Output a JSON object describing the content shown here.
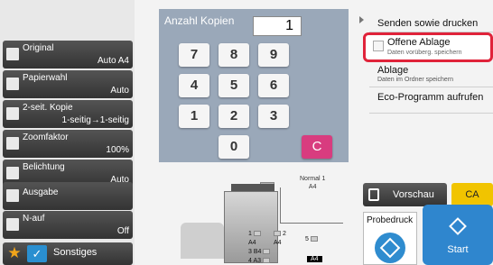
{
  "left_panel": {
    "items": [
      {
        "title": "Original",
        "value": "Auto    A4",
        "icon": "document-icon"
      },
      {
        "title": "Papierwahl",
        "value": "Auto",
        "icon": "paper-icon"
      },
      {
        "title": "2-seit. Kopie",
        "value": "1-seitig→1-seitig",
        "icon": "duplex-icon"
      },
      {
        "title": "Zoomfaktor",
        "value": "100%",
        "icon": "zoom-icon"
      },
      {
        "title": "Belichtung",
        "value": "Auto",
        "icon": "exposure-icon"
      },
      {
        "title": "Ausgabe",
        "value": "",
        "icon": "output-icon"
      },
      {
        "title": "N-auf",
        "value": "Off",
        "icon": "n-up-icon"
      }
    ],
    "bottom": {
      "other_label": "Sonstiges"
    }
  },
  "keypad": {
    "label": "Anzahl Kopien",
    "value": "1",
    "keys": [
      "7",
      "8",
      "9",
      "4",
      "5",
      "6",
      "1",
      "2",
      "3",
      "0"
    ],
    "clear_label": "C"
  },
  "printer": {
    "normal_tray": "Normal 1",
    "normal_size": "A4",
    "trays": [
      {
        "num": "1",
        "size": "A4"
      },
      {
        "num": "2",
        "size": "A4"
      },
      {
        "num": "3",
        "size": "B4"
      },
      {
        "num": "4",
        "size": "A3"
      },
      {
        "num": "5",
        "size": "A4"
      }
    ]
  },
  "right_panel": {
    "send_print": "Senden sowie drucken",
    "offene_ablage_title": "Offene Ablage",
    "offene_ablage_sub": "Daten vorüberg. speichern",
    "ablage_title": "Ablage",
    "ablage_sub": "Daten im Ordner speichern",
    "eco": "Eco-Programm aufrufen",
    "vorschau": "Vorschau",
    "ca": "CA",
    "probedruck": "Probedruck",
    "start": "Start"
  },
  "colors": {
    "accent_blue": "#2f86ce",
    "highlight_red": "#e0233a",
    "ca_yellow": "#f1c400",
    "clear_pink": "#d83c7f"
  }
}
